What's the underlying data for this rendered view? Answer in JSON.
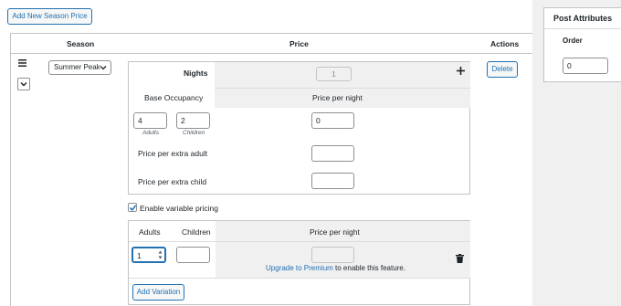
{
  "buttons": {
    "add_new_season_price": "Add New Season Price",
    "delete": "Delete",
    "add_variation": "Add Variation"
  },
  "table": {
    "headers": {
      "season": "Season",
      "price": "Price",
      "actions": "Actions"
    }
  },
  "season_select": {
    "value": "Summer Peak"
  },
  "nights": {
    "label": "Nights",
    "value": "1"
  },
  "base_occupancy": {
    "label": "Base Occupancy",
    "adults_value": "4",
    "adults_caption": "Adults",
    "children_value": "2",
    "children_caption": "Children"
  },
  "price_per_night": {
    "label": "Price per night",
    "value": "0"
  },
  "extra_adult": {
    "label": "Price per extra adult",
    "value": ""
  },
  "extra_child": {
    "label": "Price per extra child",
    "value": ""
  },
  "variable_pricing": {
    "label": "Enable variable pricing",
    "checked": true
  },
  "variations": {
    "headers": {
      "adults": "Adults",
      "children": "Children",
      "price_per_night": "Price per night"
    },
    "row": {
      "adults": "1",
      "children": "",
      "price": ""
    },
    "upgrade_link": "Upgrade to Premium",
    "upgrade_suffix": " to enable this feature."
  },
  "sidebar": {
    "title": "Post Attributes",
    "order_label": "Order",
    "order_value": "0"
  },
  "colors": {
    "accent": "#2271b1",
    "border": "#c3c4c7",
    "muted_bg": "#f0f0f1"
  }
}
